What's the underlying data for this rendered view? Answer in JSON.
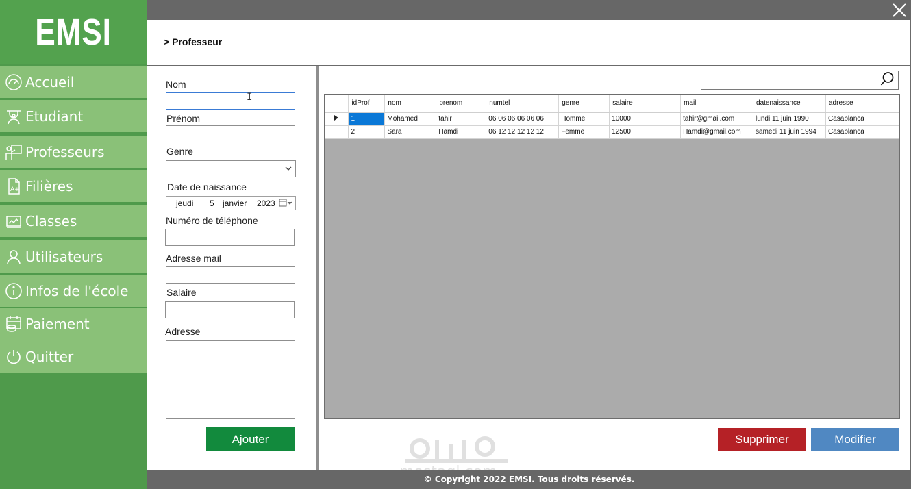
{
  "app": {
    "logo": "EMSI",
    "breadcrumb": "> Professeur"
  },
  "sidebar": {
    "items": [
      {
        "label": "Accueil",
        "icon": "dashboard-icon"
      },
      {
        "label": "Etudiant",
        "icon": "student-icon"
      },
      {
        "label": "Professeurs",
        "icon": "teacher-icon"
      },
      {
        "label": "Filières",
        "icon": "document-icon"
      },
      {
        "label": "Classes",
        "icon": "chart-board-icon"
      },
      {
        "label": "Utilisateurs",
        "icon": "user-icon"
      },
      {
        "label": "Infos de l'école",
        "icon": "info-icon"
      },
      {
        "label": "Paiement",
        "icon": "payment-icon"
      },
      {
        "label": "Quitter",
        "icon": "power-icon"
      }
    ]
  },
  "form": {
    "nom_label": "Nom",
    "prenom_label": "Prénom",
    "genre_label": "Genre",
    "date_label": "Date de naissance",
    "date": {
      "weekday": "jeudi",
      "day": "5",
      "month": "janvier",
      "year": "2023"
    },
    "phone_label": "Numéro de téléphone",
    "phone_mask": "__ __ __ __ __",
    "mail_label": "Adresse mail",
    "salaire_label": "Salaire",
    "adresse_label": "Adresse",
    "add_button": "Ajouter"
  },
  "actions": {
    "delete_button": "Supprimer",
    "edit_button": "Modifier"
  },
  "grid": {
    "columns": [
      "idProf",
      "nom",
      "prenom",
      "numtel",
      "genre",
      "salaire",
      "mail",
      "datenaissance",
      "adresse"
    ],
    "rows": [
      [
        "1",
        "Mohamed",
        "tahir",
        "06 06 06 06 06 06",
        "Homme",
        "10000",
        "tahir@gmail.com",
        "lundi 11 juin 1990",
        "Casablanca"
      ],
      [
        "2",
        "Sara",
        "Hamdi",
        "06 12 12 12 12 12",
        "Femme",
        "12500",
        "Hamdi@gmail.com",
        "samedi 11 juin 1994",
        "Casablanca"
      ]
    ]
  },
  "footer": {
    "copyright": "© Copyright 2022 EMSI. Tous droits réservés."
  },
  "watermark": {
    "text": "mostaql.com"
  },
  "colors": {
    "sidebar_dark": "#4f9a4b",
    "sidebar_item": "#8ac178",
    "add": "#128a3d",
    "delete": "#b52126",
    "edit": "#5088c2",
    "bars": "#676767",
    "selection": "#0a78d7"
  }
}
